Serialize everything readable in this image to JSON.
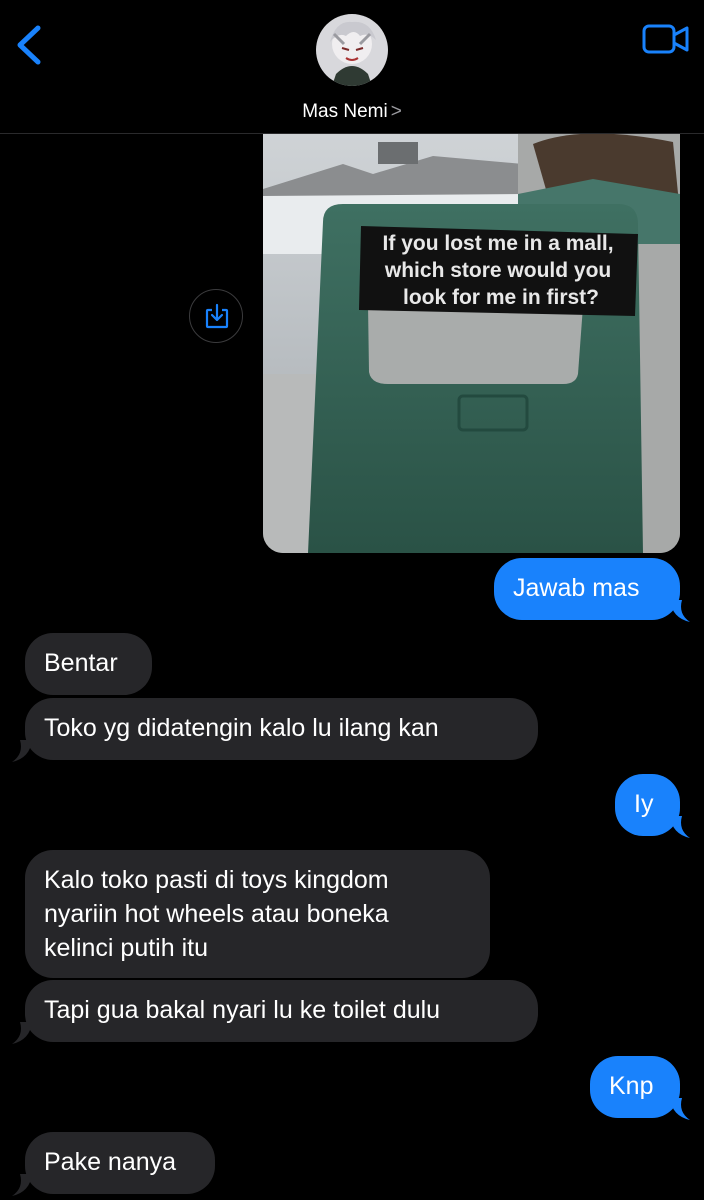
{
  "header": {
    "contact_name": "Mas Nemi",
    "name_chevron": ">",
    "back_icon": "chevron-left-icon",
    "video_icon": "video-camera-icon",
    "accent": "#1982fc"
  },
  "attachment": {
    "sticker_lines": [
      "If you lost me in a mall,",
      "which store would you",
      "look for me in first?"
    ],
    "save_icon": "save-to-photos-icon"
  },
  "messages": [
    {
      "from": "me",
      "text": "Jawab mas"
    },
    {
      "from": "them",
      "text": "Bentar"
    },
    {
      "from": "them",
      "text": "Toko yg didatengin kalo lu ilang kan"
    },
    {
      "from": "me",
      "text": "Iy"
    },
    {
      "from": "them",
      "lines": [
        "Kalo toko pasti di toys kingdom",
        "nyariin hot wheels atau boneka",
        "kelinci putih itu"
      ]
    },
    {
      "from": "them",
      "text": "Tapi gua bakal nyari lu ke toilet dulu"
    },
    {
      "from": "me",
      "text": "Knp"
    },
    {
      "from": "them",
      "text": "Pake nanya"
    }
  ],
  "colors": {
    "outgoing_bubble": "#1982fc",
    "incoming_bubble": "#262629",
    "background": "#000000"
  }
}
